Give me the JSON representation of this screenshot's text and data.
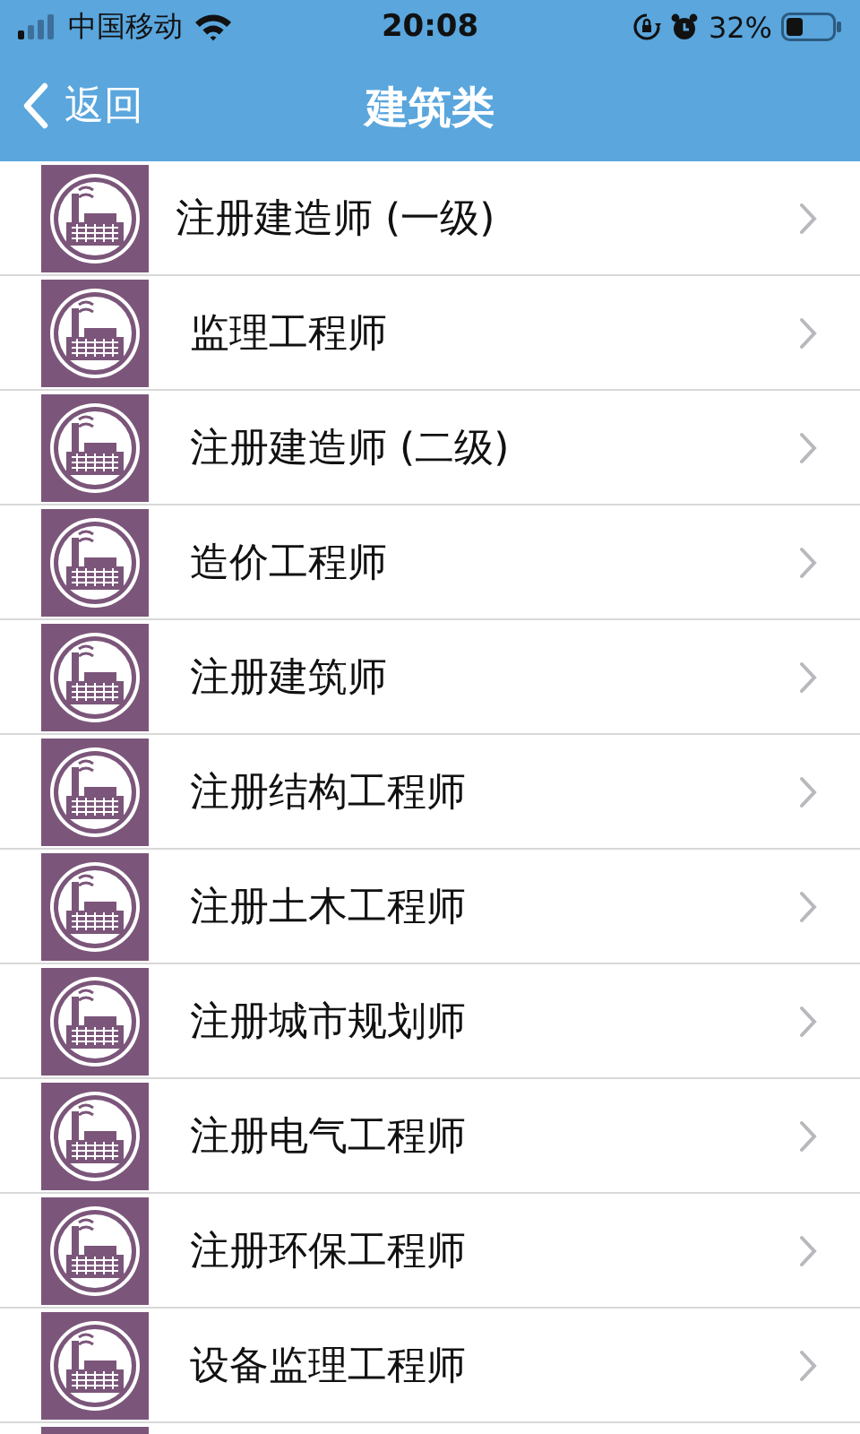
{
  "status_bar": {
    "carrier": "中国移动",
    "time": "20:08",
    "battery": "32%"
  },
  "nav": {
    "back": "返回",
    "title": "建筑类"
  },
  "items": [
    {
      "label": "注册建造师 (一级)"
    },
    {
      "label": "监理工程师"
    },
    {
      "label": "注册建造师 (二级)"
    },
    {
      "label": "造价工程师"
    },
    {
      "label": "注册建筑师"
    },
    {
      "label": "注册结构工程师"
    },
    {
      "label": "注册土木工程师"
    },
    {
      "label": "注册城市规划师"
    },
    {
      "label": "注册电气工程师"
    },
    {
      "label": "注册环保工程师"
    },
    {
      "label": "设备监理工程师"
    }
  ]
}
